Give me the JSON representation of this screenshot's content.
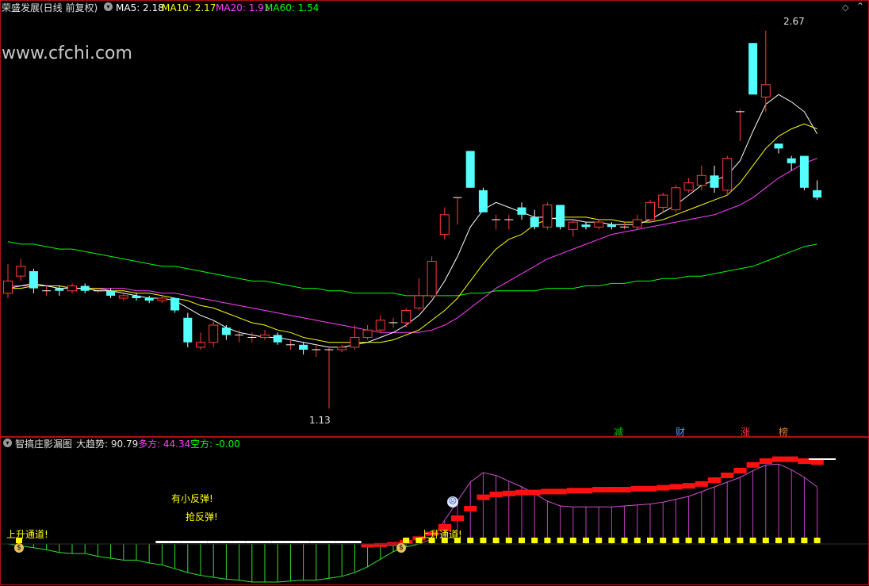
{
  "top_header": {
    "title": "荣盛发展(日线 前复权)",
    "ma5_label": "MA5: 2.18",
    "ma10_label": "MA10: 2.17",
    "ma20_label": "MA20: 1.91",
    "ma60_label": "MA60: 1.54"
  },
  "watermark": "www.cfchi.com",
  "price_annotations": {
    "high": "2.67",
    "low": "1.13"
  },
  "event_tags": [
    "减",
    "财",
    "涨",
    "榜"
  ],
  "bottom_header": {
    "indicator_name": "智搞庄影漏图",
    "trend_label": "大趋势: 90.79",
    "long_label": "多方: 44.34",
    "short_label": "空方: -0.00"
  },
  "signal_texts": {
    "small_rebound": "有小反弹!",
    "grab_rebound": "抢反弹!",
    "up_channel_1": "上升通道!",
    "up_channel_2": "上升通道!"
  },
  "colors": {
    "up": "#ff3b3b",
    "down": "#54ffff",
    "ma5": "#ffffff",
    "ma10": "#ffff00",
    "ma20": "#ff40ff",
    "ma60": "#00ff00"
  },
  "chart_data": {
    "type": "candlestick",
    "y_axis_range": [
      1.05,
      2.75
    ],
    "candles": [
      {
        "o": 1.6,
        "c": 1.65,
        "h": 1.72,
        "l": 1.58
      },
      {
        "o": 1.67,
        "c": 1.71,
        "h": 1.74,
        "l": 1.65
      },
      {
        "o": 1.69,
        "c": 1.62,
        "h": 1.7,
        "l": 1.6
      },
      {
        "o": 1.61,
        "c": 1.61,
        "h": 1.63,
        "l": 1.59
      },
      {
        "o": 1.62,
        "c": 1.61,
        "h": 1.63,
        "l": 1.59
      },
      {
        "o": 1.61,
        "c": 1.63,
        "h": 1.64,
        "l": 1.6
      },
      {
        "o": 1.63,
        "c": 1.61,
        "h": 1.64,
        "l": 1.6
      },
      {
        "o": 1.61,
        "c": 1.61,
        "h": 1.62,
        "l": 1.6
      },
      {
        "o": 1.61,
        "c": 1.59,
        "h": 1.62,
        "l": 1.58
      },
      {
        "o": 1.58,
        "c": 1.59,
        "h": 1.6,
        "l": 1.57
      },
      {
        "o": 1.59,
        "c": 1.58,
        "h": 1.6,
        "l": 1.57
      },
      {
        "o": 1.58,
        "c": 1.57,
        "h": 1.59,
        "l": 1.56
      },
      {
        "o": 1.57,
        "c": 1.58,
        "h": 1.59,
        "l": 1.56
      },
      {
        "o": 1.58,
        "c": 1.53,
        "h": 1.58,
        "l": 1.52
      },
      {
        "o": 1.5,
        "c": 1.4,
        "h": 1.52,
        "l": 1.38
      },
      {
        "o": 1.38,
        "c": 1.4,
        "h": 1.44,
        "l": 1.37
      },
      {
        "o": 1.4,
        "c": 1.47,
        "h": 1.49,
        "l": 1.38
      },
      {
        "o": 1.46,
        "c": 1.43,
        "h": 1.47,
        "l": 1.41
      },
      {
        "o": 1.43,
        "c": 1.43,
        "h": 1.45,
        "l": 1.4
      },
      {
        "o": 1.42,
        "c": 1.42,
        "h": 1.44,
        "l": 1.4
      },
      {
        "o": 1.42,
        "c": 1.43,
        "h": 1.45,
        "l": 1.41
      },
      {
        "o": 1.43,
        "c": 1.4,
        "h": 1.44,
        "l": 1.39
      },
      {
        "o": 1.39,
        "c": 1.39,
        "h": 1.41,
        "l": 1.37
      },
      {
        "o": 1.39,
        "c": 1.37,
        "h": 1.4,
        "l": 1.35
      },
      {
        "o": 1.37,
        "c": 1.37,
        "h": 1.39,
        "l": 1.34
      },
      {
        "o": 1.37,
        "c": 1.37,
        "h": 1.38,
        "l": 1.13
      },
      {
        "o": 1.37,
        "c": 1.38,
        "h": 1.39,
        "l": 1.36
      },
      {
        "o": 1.38,
        "c": 1.42,
        "h": 1.47,
        "l": 1.37
      },
      {
        "o": 1.42,
        "c": 1.45,
        "h": 1.47,
        "l": 1.41
      },
      {
        "o": 1.45,
        "c": 1.49,
        "h": 1.51,
        "l": 1.44
      },
      {
        "o": 1.48,
        "c": 1.48,
        "h": 1.5,
        "l": 1.46
      },
      {
        "o": 1.48,
        "c": 1.53,
        "h": 1.54,
        "l": 1.46
      },
      {
        "o": 1.54,
        "c": 1.59,
        "h": 1.66,
        "l": 1.53
      },
      {
        "o": 1.59,
        "c": 1.73,
        "h": 1.75,
        "l": 1.58
      },
      {
        "o": 1.84,
        "c": 1.92,
        "h": 1.95,
        "l": 1.82
      },
      {
        "o": 1.99,
        "c": 1.99,
        "h": 1.99,
        "l": 1.88
      },
      {
        "o": 2.18,
        "c": 2.03,
        "h": 2.18,
        "l": 2.03
      },
      {
        "o": 2.02,
        "c": 1.93,
        "h": 2.03,
        "l": 1.93
      },
      {
        "o": 1.9,
        "c": 1.9,
        "h": 1.92,
        "l": 1.86
      },
      {
        "o": 1.9,
        "c": 1.9,
        "h": 1.92,
        "l": 1.86
      },
      {
        "o": 1.95,
        "c": 1.92,
        "h": 1.97,
        "l": 1.9
      },
      {
        "o": 1.91,
        "c": 1.87,
        "h": 1.94,
        "l": 1.86
      },
      {
        "o": 1.87,
        "c": 1.96,
        "h": 1.97,
        "l": 1.86
      },
      {
        "o": 1.96,
        "c": 1.87,
        "h": 1.96,
        "l": 1.86
      },
      {
        "o": 1.86,
        "c": 1.89,
        "h": 1.9,
        "l": 1.83
      },
      {
        "o": 1.88,
        "c": 1.87,
        "h": 1.89,
        "l": 1.86
      },
      {
        "o": 1.87,
        "c": 1.89,
        "h": 1.9,
        "l": 1.86
      },
      {
        "o": 1.88,
        "c": 1.87,
        "h": 1.89,
        "l": 1.86
      },
      {
        "o": 1.87,
        "c": 1.87,
        "h": 1.89,
        "l": 1.86
      },
      {
        "o": 1.87,
        "c": 1.9,
        "h": 1.92,
        "l": 1.86
      },
      {
        "o": 1.9,
        "c": 1.97,
        "h": 1.98,
        "l": 1.89
      },
      {
        "o": 1.95,
        "c": 2.0,
        "h": 2.01,
        "l": 1.93
      },
      {
        "o": 1.94,
        "c": 2.03,
        "h": 2.04,
        "l": 1.93
      },
      {
        "o": 2.02,
        "c": 2.05,
        "h": 2.07,
        "l": 2.01
      },
      {
        "o": 2.04,
        "c": 2.08,
        "h": 2.12,
        "l": 2.02
      },
      {
        "o": 2.08,
        "c": 2.03,
        "h": 2.12,
        "l": 2.01
      },
      {
        "o": 2.02,
        "c": 2.15,
        "h": 2.16,
        "l": 2.0
      },
      {
        "o": 2.34,
        "c": 2.34,
        "h": 2.35,
        "l": 2.22
      },
      {
        "o": 2.62,
        "c": 2.41,
        "h": 2.62,
        "l": 2.41
      },
      {
        "o": 2.4,
        "c": 2.45,
        "h": 2.67,
        "l": 2.34
      },
      {
        "o": 2.21,
        "c": 2.19,
        "h": 2.21,
        "l": 2.17
      },
      {
        "o": 2.15,
        "c": 2.13,
        "h": 2.16,
        "l": 2.1
      },
      {
        "o": 2.16,
        "c": 2.03,
        "h": 2.16,
        "l": 2.02
      },
      {
        "o": 2.02,
        "c": 1.99,
        "h": 2.06,
        "l": 1.98
      }
    ],
    "ma5": [
      1.62,
      1.63,
      1.64,
      1.63,
      1.62,
      1.62,
      1.62,
      1.61,
      1.61,
      1.6,
      1.59,
      1.58,
      1.58,
      1.57,
      1.54,
      1.51,
      1.49,
      1.46,
      1.44,
      1.43,
      1.42,
      1.42,
      1.41,
      1.4,
      1.39,
      1.38,
      1.38,
      1.39,
      1.4,
      1.42,
      1.44,
      1.47,
      1.51,
      1.57,
      1.65,
      1.75,
      1.87,
      1.94,
      1.97,
      1.95,
      1.93,
      1.91,
      1.91,
      1.9,
      1.9,
      1.89,
      1.89,
      1.88,
      1.88,
      1.88,
      1.9,
      1.93,
      1.96,
      2.0,
      2.04,
      2.06,
      2.08,
      2.14,
      2.26,
      2.37,
      2.41,
      2.38,
      2.34,
      2.25
    ],
    "ma10": [
      1.62,
      1.62,
      1.63,
      1.63,
      1.63,
      1.62,
      1.62,
      1.62,
      1.61,
      1.61,
      1.6,
      1.6,
      1.59,
      1.58,
      1.57,
      1.55,
      1.54,
      1.52,
      1.5,
      1.48,
      1.47,
      1.45,
      1.44,
      1.42,
      1.41,
      1.4,
      1.4,
      1.4,
      1.4,
      1.4,
      1.41,
      1.43,
      1.45,
      1.49,
      1.53,
      1.58,
      1.65,
      1.72,
      1.78,
      1.82,
      1.84,
      1.88,
      1.9,
      1.91,
      1.91,
      1.91,
      1.9,
      1.9,
      1.89,
      1.89,
      1.89,
      1.9,
      1.92,
      1.94,
      1.96,
      1.98,
      2.0,
      2.05,
      2.12,
      2.19,
      2.24,
      2.27,
      2.29,
      2.27
    ],
    "ma20": [
      1.63,
      1.63,
      1.63,
      1.63,
      1.63,
      1.62,
      1.62,
      1.62,
      1.62,
      1.62,
      1.61,
      1.61,
      1.6,
      1.6,
      1.59,
      1.58,
      1.57,
      1.56,
      1.55,
      1.54,
      1.53,
      1.52,
      1.51,
      1.5,
      1.49,
      1.48,
      1.47,
      1.46,
      1.45,
      1.44,
      1.44,
      1.44,
      1.44,
      1.45,
      1.47,
      1.5,
      1.54,
      1.58,
      1.62,
      1.65,
      1.68,
      1.71,
      1.74,
      1.76,
      1.78,
      1.8,
      1.82,
      1.84,
      1.85,
      1.86,
      1.87,
      1.88,
      1.89,
      1.9,
      1.91,
      1.92,
      1.94,
      1.96,
      1.99,
      2.03,
      2.07,
      2.1,
      2.13,
      2.15
    ],
    "ma60": [
      1.81,
      1.8,
      1.8,
      1.79,
      1.78,
      1.78,
      1.77,
      1.76,
      1.75,
      1.74,
      1.73,
      1.72,
      1.71,
      1.71,
      1.7,
      1.69,
      1.68,
      1.67,
      1.66,
      1.65,
      1.65,
      1.64,
      1.63,
      1.62,
      1.62,
      1.61,
      1.61,
      1.6,
      1.6,
      1.6,
      1.6,
      1.59,
      1.59,
      1.59,
      1.59,
      1.59,
      1.6,
      1.6,
      1.61,
      1.61,
      1.61,
      1.61,
      1.62,
      1.62,
      1.62,
      1.63,
      1.63,
      1.64,
      1.64,
      1.65,
      1.65,
      1.66,
      1.66,
      1.67,
      1.67,
      1.68,
      1.69,
      1.7,
      1.71,
      1.73,
      1.75,
      1.77,
      1.79,
      1.8
    ],
    "indicator_red_bars": [
      0,
      0,
      0,
      0,
      0,
      0,
      0,
      0,
      0,
      0,
      0,
      0,
      0,
      0,
      0,
      0,
      0,
      0,
      0,
      0,
      0,
      0,
      0,
      0,
      0,
      0,
      0,
      0,
      0.5,
      1,
      2,
      4,
      8,
      13,
      21,
      30,
      40,
      52,
      55,
      56,
      57,
      57,
      58,
      58,
      59,
      59,
      60,
      60,
      60,
      61,
      61,
      62,
      63,
      64,
      66,
      70,
      75,
      80,
      86,
      90,
      92,
      92,
      90,
      89
    ],
    "indicator_green_lines": [
      0,
      -2,
      -4,
      -6,
      -9,
      -10,
      -10,
      -13,
      -15,
      -17,
      -17,
      -20,
      -22,
      -26,
      -30,
      -33,
      -35,
      -37,
      -38,
      -40,
      -40,
      -40,
      -39,
      -38,
      -38,
      -36,
      -34,
      -30,
      -24,
      -16,
      -8,
      -3,
      0,
      0,
      0,
      0,
      0,
      0,
      0,
      0,
      0,
      0,
      0,
      0,
      0,
      0,
      0,
      0,
      0,
      0,
      0,
      0,
      0,
      0,
      0,
      0,
      0,
      0,
      0,
      0,
      0,
      0,
      0,
      0
    ],
    "indicator_purple_lines": [
      0,
      0,
      0,
      0,
      0,
      0,
      0,
      0,
      0,
      0,
      0,
      0,
      0,
      0,
      0,
      0,
      0,
      0,
      0,
      0,
      0,
      0,
      0,
      0,
      0,
      0,
      0,
      0,
      0,
      0,
      0,
      0,
      0,
      5,
      25,
      45,
      65,
      75,
      72,
      66,
      60,
      53,
      45,
      40,
      39,
      39,
      39,
      39,
      40,
      41,
      42,
      44,
      47,
      50,
      55,
      60,
      65,
      70,
      77,
      83,
      84,
      78,
      70,
      60
    ]
  }
}
